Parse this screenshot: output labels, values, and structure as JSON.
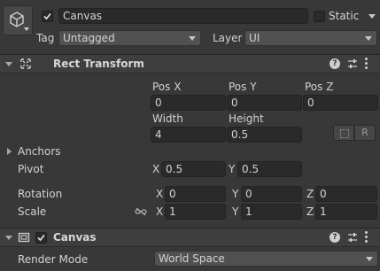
{
  "gameobject": {
    "name": "Canvas",
    "static_label": "Static",
    "tag_label": "Tag",
    "tag_value": "Untagged",
    "layer_label": "Layer",
    "layer_value": "UI",
    "icon": "cube-icon"
  },
  "rect_transform": {
    "title": "Rect Transform",
    "icon": "move-arrows-icon",
    "headers": {
      "pos_x": "Pos X",
      "pos_y": "Pos Y",
      "pos_z": "Pos Z",
      "width": "Width",
      "height": "Height"
    },
    "values": {
      "pos_x": "0",
      "pos_y": "0",
      "pos_z": "0",
      "width": "4",
      "height": "0.5"
    },
    "r_button": "R",
    "anchors_label": "Anchors",
    "pivot_label": "Pivot",
    "pivot": {
      "x_label": "X",
      "x": "0.5",
      "y_label": "Y",
      "y": "0.5"
    },
    "rotation_label": "Rotation",
    "rotation": {
      "x_label": "X",
      "x": "0",
      "y_label": "Y",
      "y": "0",
      "z_label": "Z",
      "z": "0"
    },
    "scale_label": "Scale",
    "scale": {
      "x_label": "X",
      "x": "1",
      "y_label": "Y",
      "y": "1",
      "z_label": "Z",
      "z": "1"
    }
  },
  "canvas": {
    "title": "Canvas",
    "icon": "canvas-icon",
    "render_mode_label": "Render Mode",
    "render_mode_value": "World Space"
  },
  "header_icons": [
    "help-icon",
    "preset-sliders-icon",
    "kebab-menu-icon"
  ]
}
